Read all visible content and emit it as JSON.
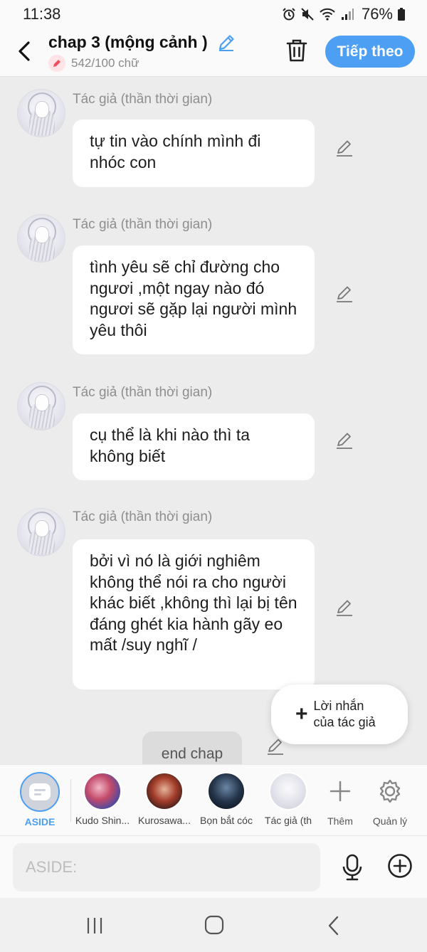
{
  "status": {
    "time": "11:38",
    "battery": "76%"
  },
  "header": {
    "title": "chap 3 (mộng cảnh )",
    "word_count": "542/100 chữ",
    "next_label": "Tiếp theo"
  },
  "messages": [
    {
      "sender": "Tác giả (thần thời gian)",
      "text": "tự tin vào chính mình đi nhóc con"
    },
    {
      "sender": "Tác giả (thần thời gian)",
      "text": "tình yêu sẽ chỉ đường cho ngươi ,một ngay nào đó ngươi sẽ gặp lại người mình yêu thôi"
    },
    {
      "sender": "Tác giả (thần thời gian)",
      "text": "cụ thể là khi nào thì ta không biết"
    },
    {
      "sender": "Tác giả (thần thời gian)",
      "text": "bởi vì nó là giới nghiêm không thể nói ra cho người khác biết ,không thì lại bị tên đáng ghét kia hành gãy eo mất /suy nghĩ /"
    }
  ],
  "system_message": "end chap",
  "author_note": {
    "plus": "+",
    "line1": "Lời nhắn",
    "line2": "của tác giả"
  },
  "characters": [
    {
      "name": "ASIDE",
      "color": "#4c9ff2"
    },
    {
      "name": "Kudo Shin...",
      "color": "#444444"
    },
    {
      "name": "Kurosawa...",
      "color": "#444444"
    },
    {
      "name": "Bọn bắt cóc",
      "color": "#444444"
    },
    {
      "name": "Tác giả (th",
      "color": "#444444"
    }
  ],
  "tools": {
    "add_label": "Thêm",
    "manage_label": "Quản lý"
  },
  "input": {
    "placeholder": "ASIDE:"
  },
  "colors": {
    "accent": "#4c9ff2",
    "bubble": "#ffffff",
    "chat_bg": "#ececec"
  }
}
